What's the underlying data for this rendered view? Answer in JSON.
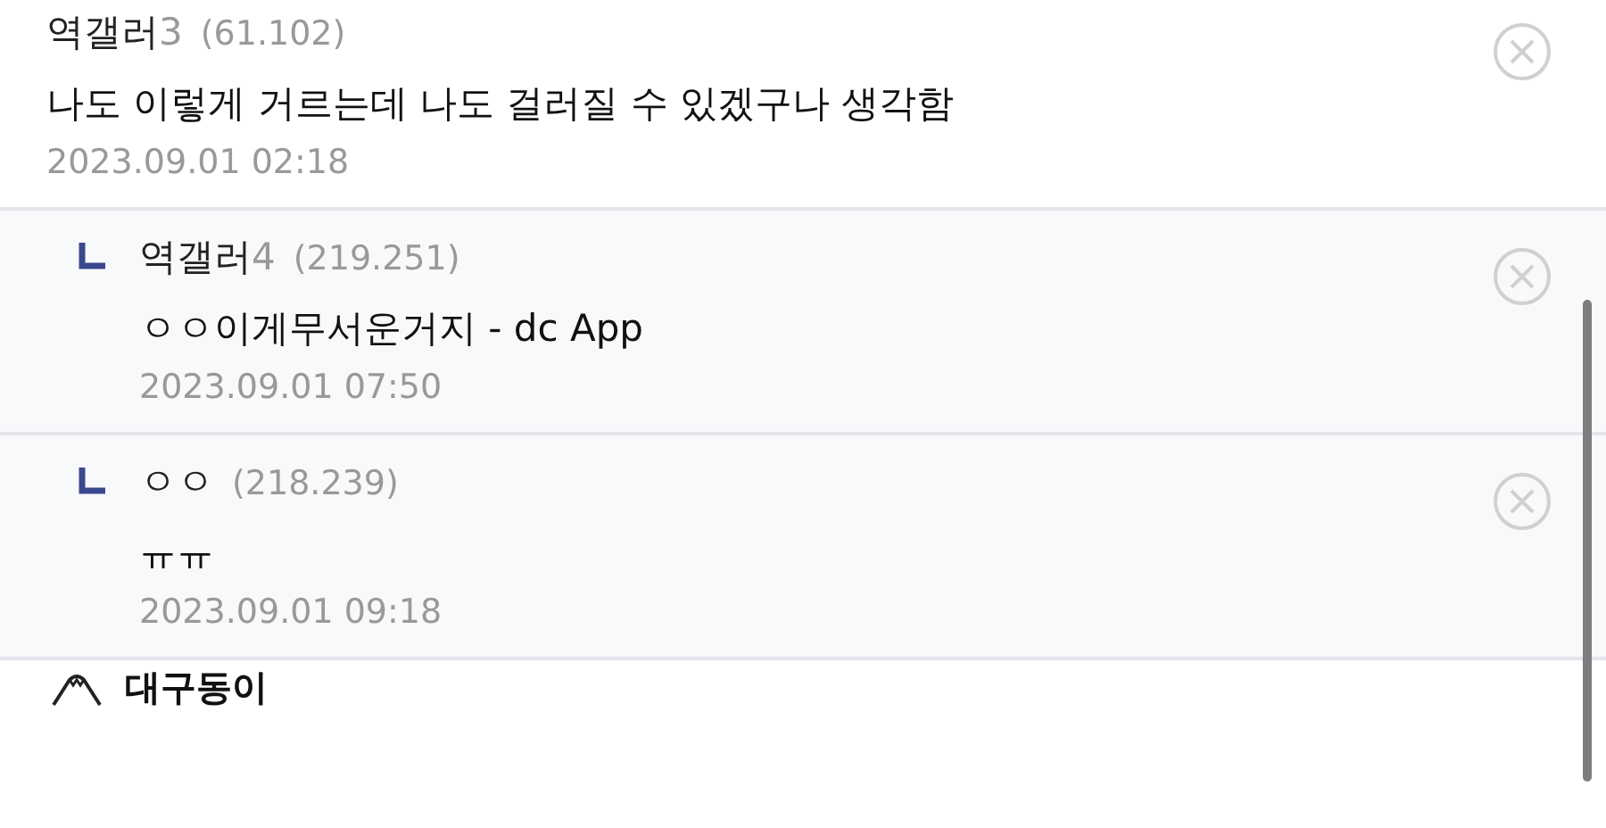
{
  "comments": [
    {
      "kind": "comment",
      "name": "역갤러",
      "name_suffix": "3",
      "ip": "(61.102)",
      "text": "나도 이렇게 거르는데 나도 걸러질 수 있겠구나 생각함",
      "date": "2023.09.01 02:18"
    },
    {
      "kind": "reply",
      "name": "역갤러",
      "name_suffix": "4",
      "ip": "(219.251)",
      "text": "ㅇㅇ이게무서운거지 - dc App",
      "date": "2023.09.01 07:50"
    },
    {
      "kind": "reply",
      "name": "ㅇㅇ",
      "ip": "(218.239)",
      "text": "ㅠㅠ",
      "date": "2023.09.01 09:18"
    }
  ],
  "next_author": {
    "name": "대구동이"
  }
}
